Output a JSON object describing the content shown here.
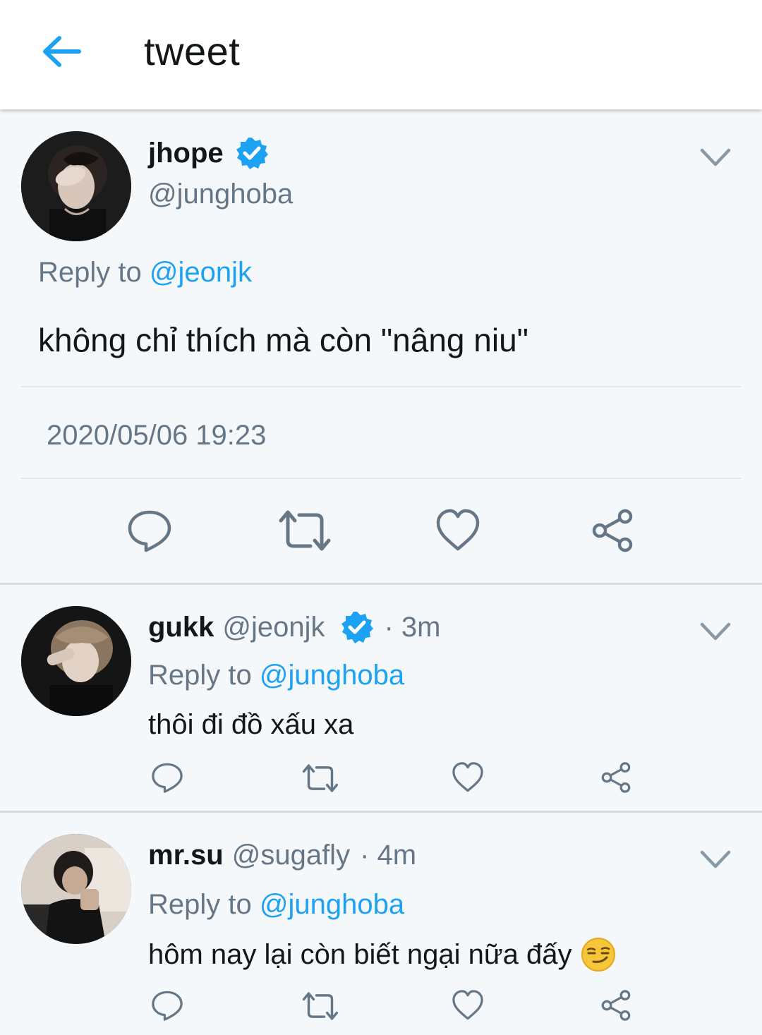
{
  "header": {
    "title": "tweet",
    "back_icon": "arrow-left-icon",
    "accent": "#1da1f2"
  },
  "main_tweet": {
    "display_name": "jhope",
    "handle": "@junghoba",
    "verified": true,
    "reply_prefix": "Reply to",
    "reply_to": "@jeonjk",
    "text": "không chỉ thích mà còn \"nâng niu\"",
    "timestamp": "2020/05/06 19:23",
    "actions": [
      "reply-icon",
      "retweet-icon",
      "like-icon",
      "share-icon"
    ]
  },
  "replies": [
    {
      "display_name": "gukk",
      "handle": "@jeonjk",
      "verified": true,
      "time": "· 3m",
      "reply_prefix": "Reply to",
      "reply_to": "@junghoba",
      "text": "thôi đi đồ xấu xa"
    },
    {
      "display_name": "mr.su",
      "handle": "@sugafly",
      "verified": false,
      "time": "· 4m",
      "reply_prefix": "Reply to",
      "reply_to": "@junghoba",
      "text": "hôm nay lại còn biết ngại nữa đấy",
      "emoji": "smirking-face"
    }
  ],
  "colors": {
    "text": "#14171a",
    "secondary": "#657786",
    "link": "#1da1f2",
    "background": "#f5f8fa"
  }
}
